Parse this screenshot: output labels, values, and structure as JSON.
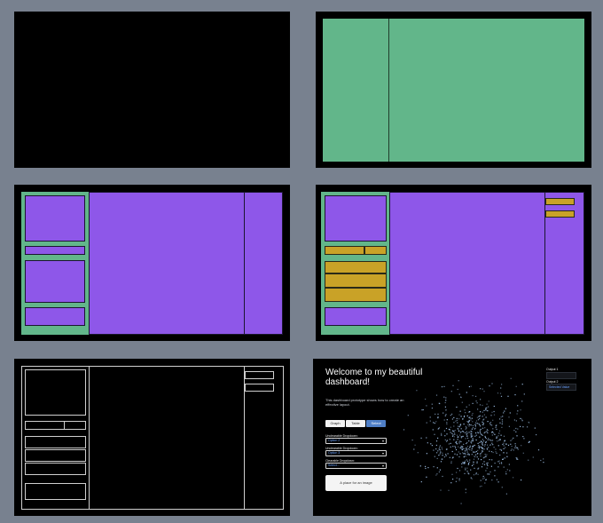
{
  "dashboard": {
    "title": "Welcome to my beautiful dashboard!",
    "description": "This dashboard prototype shows how to create an effective layout.",
    "tabs": [
      {
        "label": "Graph",
        "active": false
      },
      {
        "label": "Table",
        "active": false
      },
      {
        "label": "Select",
        "active": true
      }
    ],
    "dropdowns": [
      {
        "label": "Unclearable Dropdown:",
        "value": "Option 2"
      },
      {
        "label": "Unclearable Dropdown:",
        "value": "Option 3"
      },
      {
        "label": "Clearable Dropdown:",
        "value": "Select..."
      }
    ],
    "upload_label": "A place for an image",
    "outputs": [
      {
        "label": "Output 1",
        "value": ""
      },
      {
        "label": "Output 2",
        "value": "Selected Value"
      }
    ]
  },
  "colors": {
    "page_background": "#78818f",
    "panel_background": "#000000",
    "green": "#62b68a",
    "purple": "#8e57e9",
    "gold": "#c9a227",
    "accent_blue": "#4f7fc7",
    "scatter_points": "#9fc0e6"
  }
}
